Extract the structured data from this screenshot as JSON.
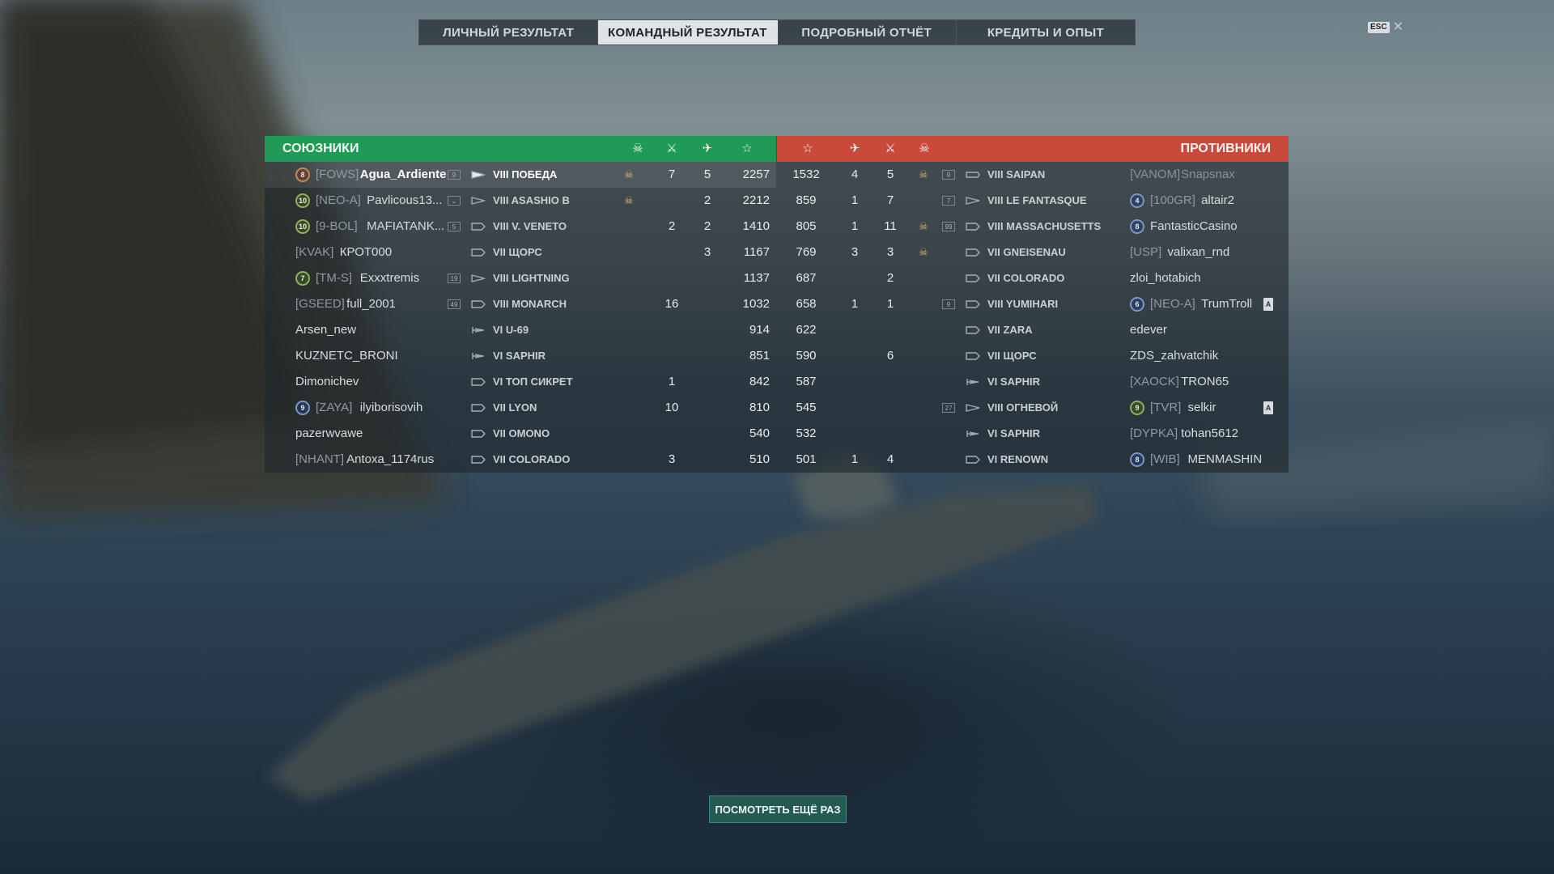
{
  "tabs": [
    {
      "label": "ЛИЧНЫЙ РЕЗУЛЬТАТ",
      "active": false
    },
    {
      "label": "КОМАНДНЫЙ РЕЗУЛЬТАТ",
      "active": true
    },
    {
      "label": "ПОДРОБНЫЙ ОТЧЁТ",
      "active": false
    },
    {
      "label": "КРЕДИТЫ И ОПЫТ",
      "active": false
    }
  ],
  "esc": {
    "key_label": "ESC",
    "close_glyph": "✕"
  },
  "allies": {
    "title": "СОЮЗНИКИ",
    "header_icons": [
      "skull-icon",
      "crossed-swords-icon",
      "plane-icon",
      "star-icon"
    ],
    "rows": [
      {
        "medal": "8",
        "medal_color": "orange",
        "clan": "[FOWS]",
        "name": "Agua_Ardiente",
        "division": "9",
        "ship_class": "destroyer-filled",
        "ship": "VIII ПОБЕДА",
        "skull": true,
        "kills": "7",
        "planes": "5",
        "xp": "2257",
        "highlight": true
      },
      {
        "medal": "10",
        "medal_color": "green",
        "clan": "[NEO-A]",
        "name": "Pavlicous13...",
        "division": "chevron",
        "ship_class": "destroyer",
        "ship": "VIII ASASHIO B",
        "skull": true,
        "kills": "",
        "planes": "2",
        "xp": "2212"
      },
      {
        "medal": "10",
        "medal_color": "green",
        "clan": "[9-BOL]",
        "name": "MAFIATANK...",
        "division": "5",
        "ship_class": "battleship",
        "ship": "VIII V. VENETO",
        "skull": false,
        "kills": "2",
        "planes": "2",
        "xp": "1410"
      },
      {
        "medal": "",
        "clan": "[KVAK]",
        "name": "КРОТ000",
        "division": "",
        "ship_class": "battleship",
        "ship": "VII ЩОРС",
        "skull": false,
        "kills": "",
        "planes": "3",
        "xp": "1167"
      },
      {
        "medal": "7",
        "medal_color": "green",
        "clan": "[TM-S]",
        "name": "Exxxtremis",
        "division": "19",
        "ship_class": "destroyer",
        "ship": "VIII LIGHTNING",
        "skull": false,
        "kills": "",
        "planes": "",
        "xp": "1137"
      },
      {
        "medal": "",
        "clan": "[GSEED]",
        "name": "full_2001",
        "division": "49",
        "ship_class": "battleship",
        "ship": "VIII MONARCH",
        "skull": false,
        "kills": "16",
        "planes": "",
        "xp": "1032"
      },
      {
        "medal": "",
        "clan": "",
        "name": "Arsen_new",
        "division": "",
        "ship_class": "submarine",
        "ship": "VI U-69",
        "skull": false,
        "kills": "",
        "planes": "",
        "xp": "914"
      },
      {
        "medal": "",
        "clan": "",
        "name": "KUZNETC_BRONI",
        "division": "",
        "ship_class": "submarine",
        "ship": "VI SAPHIR",
        "skull": false,
        "kills": "",
        "planes": "",
        "xp": "851"
      },
      {
        "medal": "",
        "clan": "",
        "name": "Dimonichev",
        "division": "",
        "ship_class": "battleship",
        "ship": "VI ТОП СИКРЕТ",
        "skull": false,
        "kills": "1",
        "planes": "",
        "xp": "842"
      },
      {
        "medal": "9",
        "medal_color": "blue",
        "clan": "[ZAYA]",
        "name": "ilyiborisovih",
        "division": "",
        "ship_class": "battleship",
        "ship": "VII LYON",
        "skull": false,
        "kills": "10",
        "planes": "",
        "xp": "810"
      },
      {
        "medal": "",
        "clan": "",
        "name": "pazerwvawe",
        "division": "",
        "ship_class": "battleship",
        "ship": "VII OMONO",
        "skull": false,
        "kills": "",
        "planes": "",
        "xp": "540"
      },
      {
        "medal": "",
        "clan": "[NHANT]",
        "name": "Antoxa_1174rus",
        "division": "",
        "ship_class": "battleship",
        "ship": "VII COLORADO",
        "skull": false,
        "kills": "3",
        "planes": "",
        "xp": "510"
      }
    ]
  },
  "enemies": {
    "title": "ПРОТИВНИКИ",
    "header_icons": [
      "star-icon",
      "plane-icon",
      "crossed-swords-icon",
      "skull-icon"
    ],
    "rows": [
      {
        "xp": "1532",
        "planes": "4",
        "kills": "5",
        "skull": true,
        "division": "9",
        "ship_class": "carrier",
        "ship": "VIII SAIPAN",
        "medal": "",
        "clan": "[VANOM]",
        "name": "Snapsnax",
        "rank": false,
        "dim": true
      },
      {
        "xp": "859",
        "planes": "1",
        "kills": "7",
        "skull": false,
        "division": "7",
        "ship_class": "destroyer",
        "ship": "VIII LE FANTASQUE",
        "medal": "4",
        "medal_color": "blue",
        "clan": "[100GR]",
        "name": "altair2",
        "rank": false
      },
      {
        "xp": "805",
        "planes": "1",
        "kills": "11",
        "skull": true,
        "division": "99",
        "ship_class": "battleship",
        "ship": "VIII MASSACHUSETTS",
        "medal": "8",
        "medal_color": "blue",
        "clan": "",
        "name": "FantasticCasino",
        "rank": false
      },
      {
        "xp": "769",
        "planes": "3",
        "kills": "3",
        "skull": true,
        "division": "",
        "ship_class": "battleship",
        "ship": "VII GNEISENAU",
        "medal": "",
        "clan": "[USP]",
        "name": "valixan_rnd",
        "rank": false
      },
      {
        "xp": "687",
        "planes": "",
        "kills": "2",
        "skull": false,
        "division": "",
        "ship_class": "battleship",
        "ship": "VII COLORADO",
        "medal": "",
        "clan": "",
        "name": "zloi_hotabich",
        "rank": false
      },
      {
        "xp": "658",
        "planes": "1",
        "kills": "1",
        "skull": false,
        "division": "9",
        "ship_class": "battleship",
        "ship": "VIII YUMIHARI",
        "medal": "6",
        "medal_color": "blue",
        "clan": "[NEO-A]",
        "name": "TrumTroll",
        "rank": true
      },
      {
        "xp": "622",
        "planes": "",
        "kills": "",
        "skull": false,
        "division": "",
        "ship_class": "battleship",
        "ship": "VII ZARA",
        "medal": "",
        "clan": "",
        "name": "edever",
        "rank": false
      },
      {
        "xp": "590",
        "planes": "",
        "kills": "6",
        "skull": false,
        "division": "",
        "ship_class": "battleship",
        "ship": "VII ЩОРС",
        "medal": "",
        "clan": "",
        "name": "ZDS_zahvatchik",
        "rank": false
      },
      {
        "xp": "587",
        "planes": "",
        "kills": "",
        "skull": false,
        "division": "",
        "ship_class": "submarine",
        "ship": "VI SAPHIR",
        "medal": "",
        "clan": "[XAOCK]",
        "name": "TRON65",
        "rank": false
      },
      {
        "xp": "545",
        "planes": "",
        "kills": "",
        "skull": false,
        "division": "27",
        "ship_class": "destroyer",
        "ship": "VIII ОГНЕВОЙ",
        "medal": "9",
        "medal_color": "green",
        "clan": "[TVR]",
        "name": "selkir",
        "rank": true
      },
      {
        "xp": "532",
        "planes": "",
        "kills": "",
        "skull": false,
        "division": "",
        "ship_class": "submarine",
        "ship": "VI SAPHIR",
        "medal": "",
        "clan": "[DYPKA]",
        "name": "tohan5612",
        "rank": false
      },
      {
        "xp": "501",
        "planes": "1",
        "kills": "4",
        "skull": false,
        "division": "",
        "ship_class": "battleship",
        "ship": "VI RENOWN",
        "medal": "8",
        "medal_color": "blue",
        "clan": "[WIB]",
        "name": "MENMASHIN",
        "rank": false
      }
    ]
  },
  "rank_badge_letter": "A",
  "replay_button": {
    "label": "ПОСМОТРЕТЬ ЕЩЁ РАЗ"
  },
  "colors": {
    "ally": "#1f9b55",
    "enemy": "#c94a3b",
    "replay": "#245a52"
  }
}
